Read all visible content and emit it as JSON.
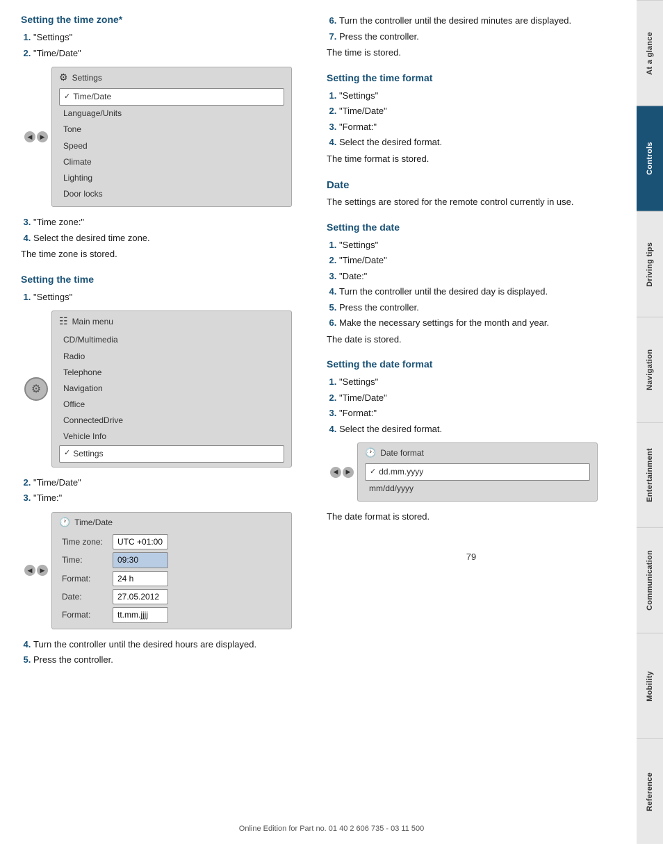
{
  "page": {
    "footer_text": "Online Edition for Part no. 01 40 2 606 735 - 03 11 500",
    "page_number": "79"
  },
  "sidebar": {
    "tabs": [
      {
        "id": "at-a-glance",
        "label": "At a glance",
        "active": false
      },
      {
        "id": "controls",
        "label": "Controls",
        "active": true
      },
      {
        "id": "driving-tips",
        "label": "Driving tips",
        "active": false
      },
      {
        "id": "navigation",
        "label": "Navigation",
        "active": false
      },
      {
        "id": "entertainment",
        "label": "Entertainment",
        "active": false
      },
      {
        "id": "communication",
        "label": "Communication",
        "active": false
      },
      {
        "id": "mobility",
        "label": "Mobility",
        "active": false
      },
      {
        "id": "reference",
        "label": "Reference",
        "active": false
      }
    ]
  },
  "left_col": {
    "section1": {
      "heading": "Setting the time zone*",
      "steps": [
        "\"Settings\"",
        "\"Time/Date\""
      ],
      "screen_title": "Settings",
      "screen_items": [
        {
          "text": "Time/Date",
          "selected": true
        },
        {
          "text": "Language/Units",
          "selected": false
        },
        {
          "text": "Tone",
          "selected": false
        },
        {
          "text": "Speed",
          "selected": false
        },
        {
          "text": "Climate",
          "selected": false
        },
        {
          "text": "Lighting",
          "selected": false
        },
        {
          "text": "Door locks",
          "selected": false
        }
      ],
      "steps2": [
        "\"Time zone:\"",
        "Select the desired time zone."
      ],
      "result": "The time zone is stored."
    },
    "section2": {
      "heading": "Setting the time",
      "steps1": [
        "\"Settings\""
      ],
      "main_menu_title": "Main menu",
      "main_menu_items": [
        {
          "text": "CD/Multimedia",
          "selected": false
        },
        {
          "text": "Radio",
          "selected": false
        },
        {
          "text": "Telephone",
          "selected": false
        },
        {
          "text": "Navigation",
          "selected": false
        },
        {
          "text": "Office",
          "selected": false
        },
        {
          "text": "ConnectedDrive",
          "selected": false
        },
        {
          "text": "Vehicle Info",
          "selected": false
        },
        {
          "text": "Settings",
          "selected": true
        }
      ],
      "steps2": [
        "\"Time/Date\"",
        "\"Time:\""
      ],
      "timedate_screen_title": "Time/Date",
      "timedate_rows": [
        {
          "label": "Time zone:",
          "value": "UTC +01:00",
          "highlight": false
        },
        {
          "label": "Time:",
          "value": "09:30",
          "highlight": true
        },
        {
          "label": "Format:",
          "value": "24 h",
          "highlight": false
        },
        {
          "label": "Date:",
          "value": "27.05.2012",
          "highlight": false
        },
        {
          "label": "Format:",
          "value": "tt.mm.jjjj",
          "highlight": false
        }
      ],
      "steps3": [
        "Turn the controller until the desired hours are displayed.",
        "Press the controller."
      ]
    }
  },
  "right_col": {
    "continued_steps": [
      "Turn the controller until the desired minutes are displayed.",
      "Press the controller."
    ],
    "continued_result": "The time is stored.",
    "section_time_format": {
      "heading": "Setting the time format",
      "steps": [
        "\"Settings\"",
        "\"Time/Date\"",
        "\"Format:\"",
        "Select the desired format."
      ],
      "result": "The time format is stored."
    },
    "section_date_heading": "Date",
    "section_date_intro": "The settings are stored for the remote control currently in use.",
    "section_setting_date": {
      "heading": "Setting the date",
      "steps": [
        "\"Settings\"",
        "\"Time/Date\"",
        "\"Date:\"",
        "Turn the controller until the desired day is displayed.",
        "Press the controller.",
        "Make the necessary settings for the month and year."
      ],
      "result": "The date is stored."
    },
    "section_date_format": {
      "heading": "Setting the date format",
      "steps": [
        "\"Settings\"",
        "\"Time/Date\"",
        "\"Format:\"",
        "Select the desired format."
      ],
      "screen_title": "Date format",
      "screen_items": [
        {
          "text": "dd.mm.yyyy",
          "selected": true
        },
        {
          "text": "mm/dd/yyyy",
          "selected": false
        }
      ],
      "result": "The date format is stored."
    }
  }
}
